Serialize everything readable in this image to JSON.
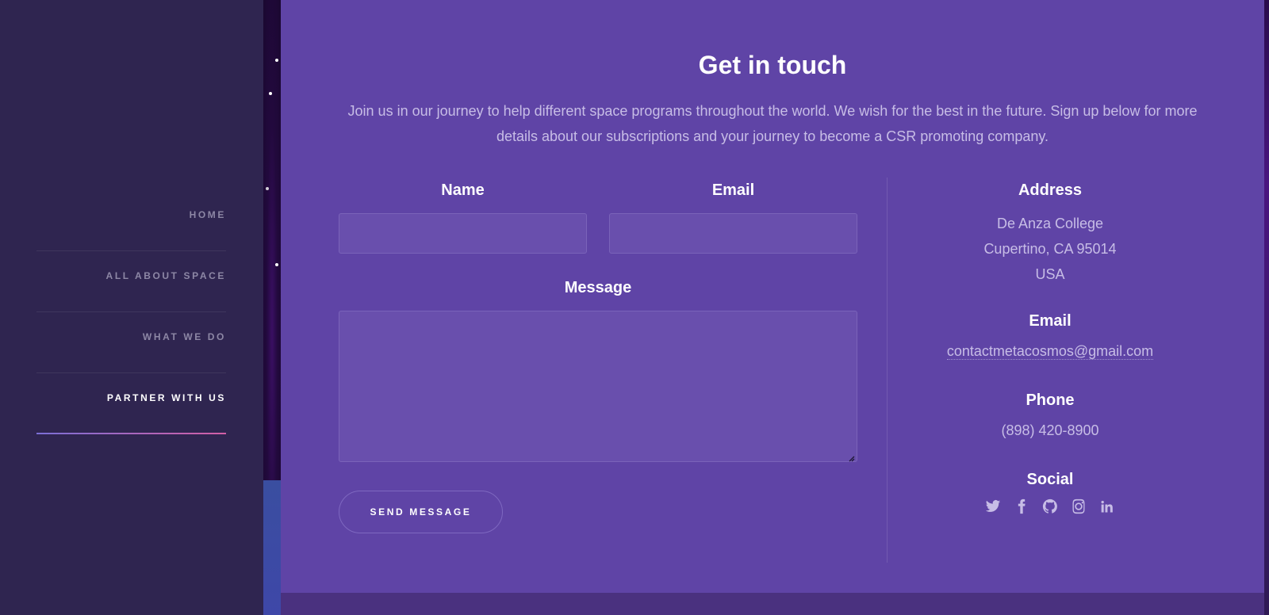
{
  "nav": {
    "items": [
      {
        "label": "HOME",
        "active": false
      },
      {
        "label": "ALL ABOUT SPACE",
        "active": false
      },
      {
        "label": "WHAT WE DO",
        "active": false
      },
      {
        "label": "PARTNER WITH US",
        "active": true
      }
    ]
  },
  "contact": {
    "title": "Get in touch",
    "intro": "Join us in our journey to help different space programs throughout the world. We wish for the best in the future. Sign up below for more details about our subscriptions and your journey to become a CSR promoting company.",
    "form": {
      "name_label": "Name",
      "name_value": "",
      "email_label": "Email",
      "email_value": "",
      "message_label": "Message",
      "message_value": "",
      "send_label": "SEND MESSAGE"
    },
    "info": {
      "address_title": "Address",
      "address_line1": "De Anza College",
      "address_line2": "Cupertino, CA 95014",
      "address_line3": "USA",
      "email_title": "Email",
      "email": "contactmetacosmos@gmail.com",
      "phone_title": "Phone",
      "phone": "(898) 420-8900",
      "social_title": "Social",
      "socials": [
        "twitter-icon",
        "facebook-icon",
        "github-icon",
        "instagram-icon",
        "linkedin-icon"
      ]
    }
  },
  "colors": {
    "sidebar": "#2f2550",
    "panel": "#5f44a6",
    "accent_gradient_start": "#7b6fd6",
    "accent_gradient_end": "#d35fa6"
  }
}
